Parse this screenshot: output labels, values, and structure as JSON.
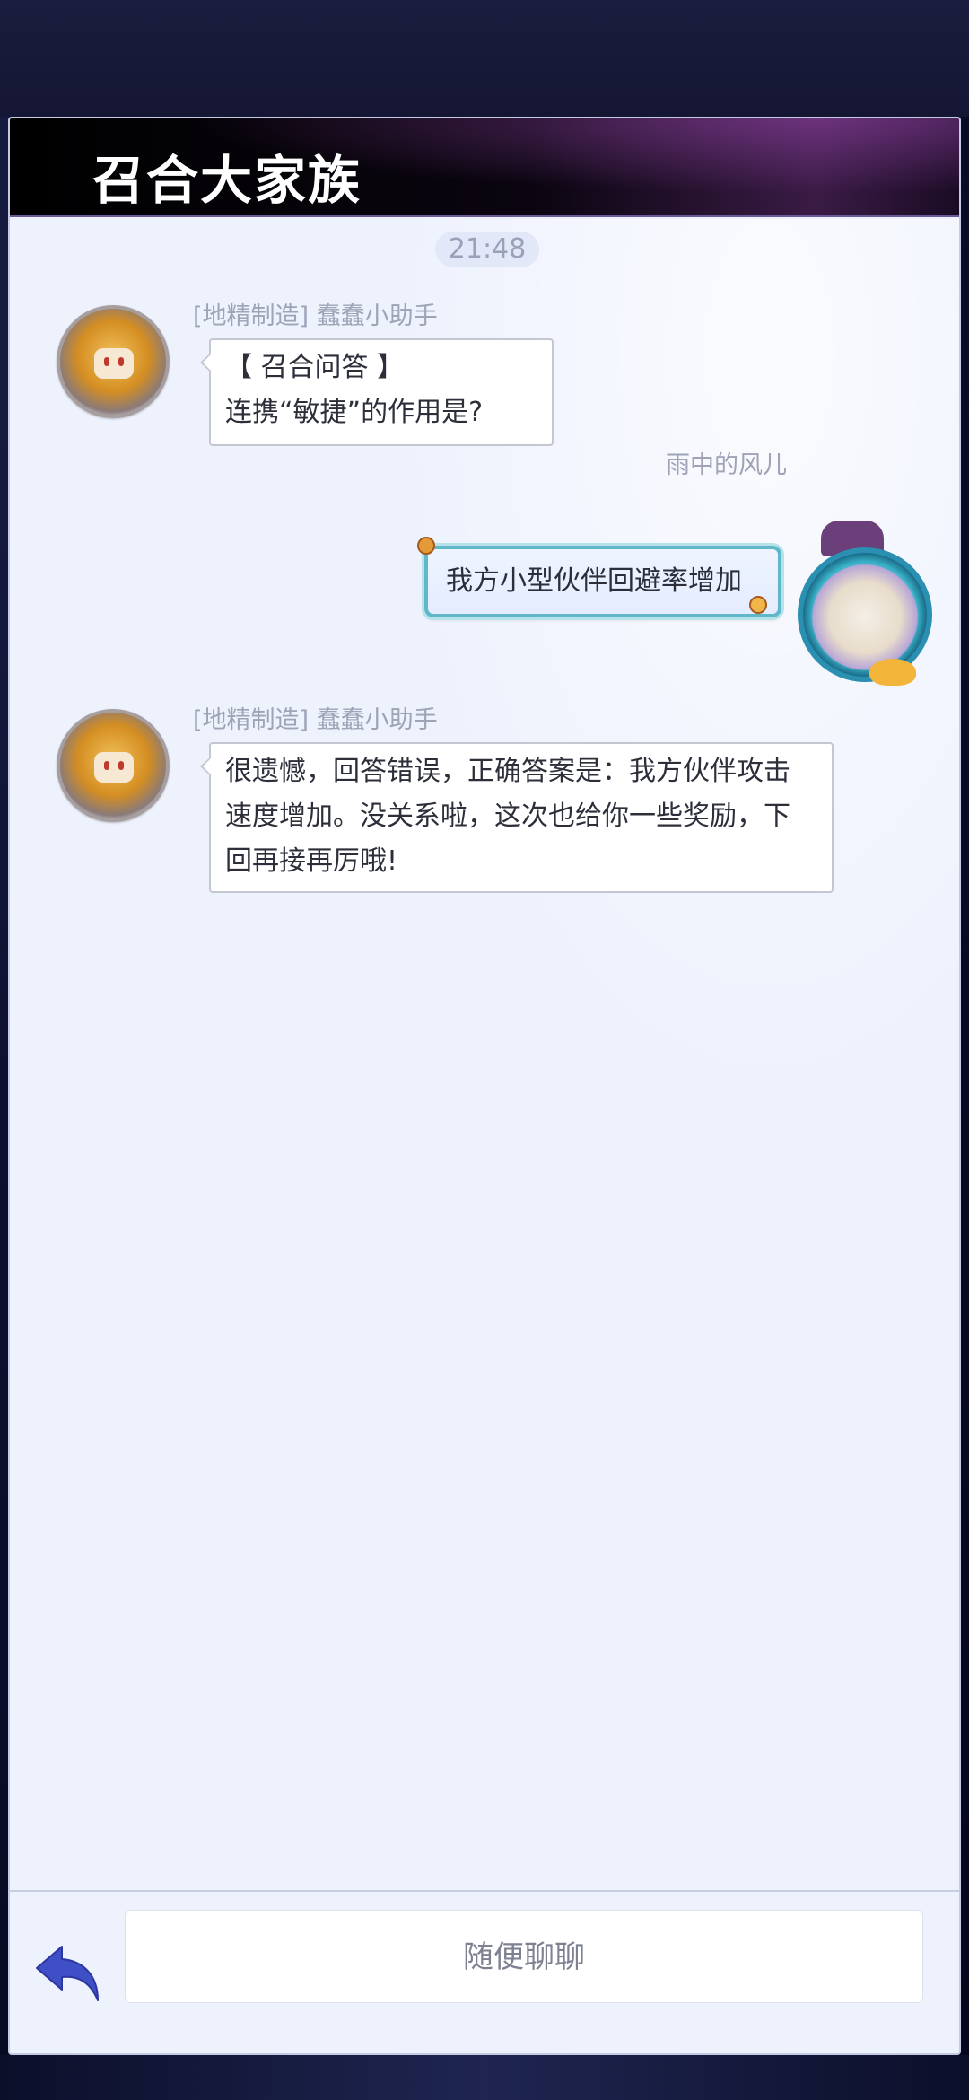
{
  "header": {
    "title": "召合大家族"
  },
  "chat": {
    "timestamp": "21:48",
    "messages": [
      {
        "sender": "[地精制造] 蠢蠢小助手",
        "lines": [
          "【 召合问答 】",
          "连携“敏捷”的作用是?"
        ]
      },
      {
        "sender": "雨中的风儿",
        "lines": [
          "我方小型伙伴回避率增加"
        ]
      },
      {
        "sender": "[地精制造] 蠢蠢小助手",
        "lines": [
          "很遗憾，回答错误，正确答案是：我方伙伴攻击",
          "速度增加。没关系啦，这次也给你一些奖励，下",
          "回再接再厉哦!"
        ]
      }
    ]
  },
  "footer": {
    "input_placeholder": "随便聊聊",
    "back_icon": "back-arrow-icon",
    "accent_color": "#3f4fc6"
  }
}
